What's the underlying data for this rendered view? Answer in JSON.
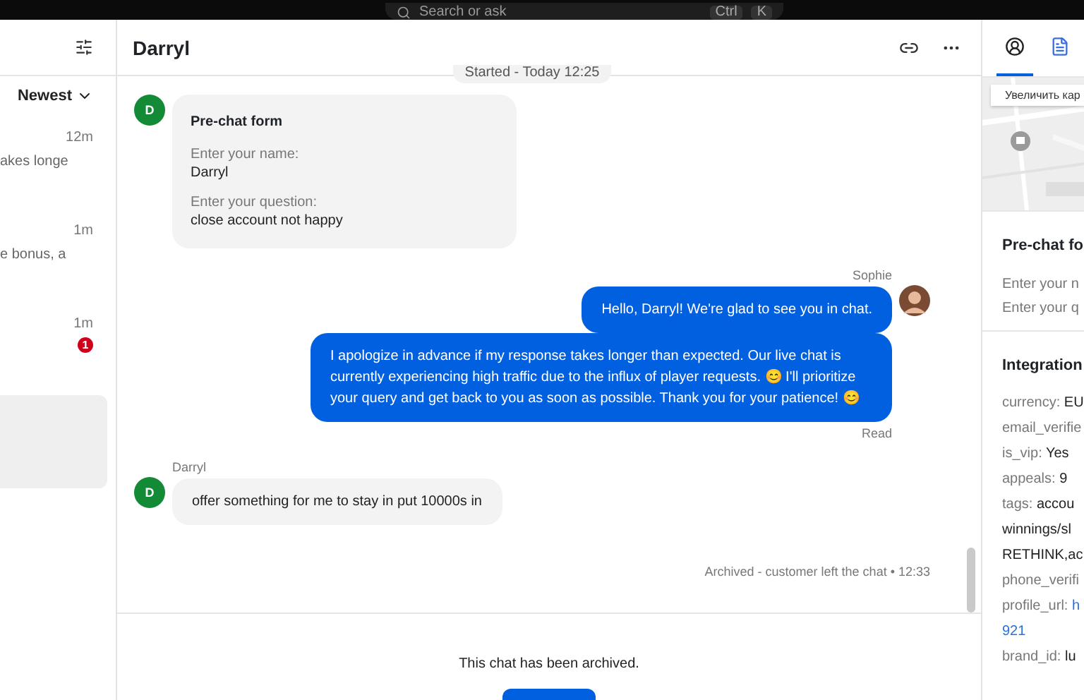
{
  "top_bar": {
    "search_placeholder": "Search or ask",
    "shortcut_keys": [
      "Ctrl",
      "K"
    ]
  },
  "sidebar": {
    "sort": "Newest",
    "items": [
      {
        "time": "12m",
        "snippet": "akes longe",
        "selected": false
      },
      {
        "time": "1m",
        "snippet": "e bonus, a",
        "selected": false
      },
      {
        "time": "1m",
        "unread": "1",
        "selected": false
      },
      {
        "selected": true
      }
    ]
  },
  "chat": {
    "title": "Darryl",
    "started": "Started - Today 12:25",
    "messages": [
      {
        "kind": "form",
        "initial": "D",
        "title": "Pre-chat form",
        "fields": [
          {
            "label": "Enter your name:",
            "value": "Darryl"
          },
          {
            "label": "Enter your question:",
            "value": "close account not happy"
          }
        ]
      },
      {
        "kind": "agent",
        "sender": "Sophie",
        "text": "Hello, Darryl! We're glad to see you in chat."
      },
      {
        "kind": "agent",
        "text": "I apologize in advance if my response takes longer than expected. Our live chat is currently experiencing high traffic due to the influx of player requests. 😊 I'll prioritize your query and get back to you as soon as possible. Thank you for your patience! 😊",
        "status": "Read"
      },
      {
        "kind": "customer",
        "sender": "Darryl",
        "initial": "D",
        "text": "offer something for me to stay in put 10000s in"
      },
      {
        "kind": "system",
        "text": "Archived - customer left the chat • 12:33"
      }
    ],
    "footer": "This chat has been archived."
  },
  "details": {
    "tabs": [
      {
        "kind": "person",
        "selected": true
      },
      {
        "kind": "document",
        "selected": false
      }
    ],
    "map_button": "Увеличить кар",
    "prechat": {
      "title": "Pre-chat fo",
      "lines": [
        "Enter your n",
        "Enter your q"
      ]
    },
    "integration": {
      "title": "Integration",
      "fields": [
        {
          "label": "currency:",
          "value": "EU"
        },
        {
          "label": "email_verifie"
        },
        {
          "label": "is_vip:",
          "value": "Yes"
        },
        {
          "label": "appeals:",
          "value": "9"
        },
        {
          "label": "tags:",
          "value": "accou",
          "more": [
            "winnings/sl",
            "RETHINK,ac"
          ]
        },
        {
          "label": "phone_verifi"
        },
        {
          "label": "profile_url:",
          "value": "h",
          "link": true,
          "more": [
            "921"
          ]
        },
        {
          "label": "brand_id:",
          "value": "lu"
        }
      ]
    }
  }
}
